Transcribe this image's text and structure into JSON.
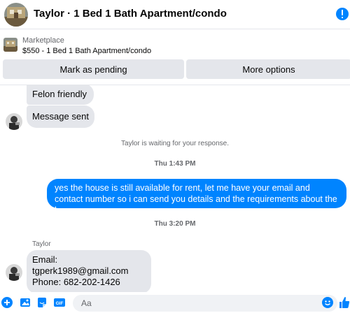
{
  "header": {
    "title": "Taylor · 1 Bed 1 Bath Apartment/condo"
  },
  "marketplace": {
    "label": "Marketplace",
    "listing": "$550 - 1 Bed 1 Bath Apartment/condo",
    "mark_pending": "Mark as pending",
    "more_options": "More options"
  },
  "messages": {
    "in1": "Felon friendly",
    "in2": "Message sent",
    "system_waiting": "Taylor is waiting for your response.",
    "time1": "Thu 1:43 PM",
    "out1": "yes the house is still available for rent, let me have your email  and contact number so i can send you details and the requirements about the house",
    "time2": "Thu 3:20 PM",
    "sender_name": "Taylor",
    "in3_line1": "Email: tgperk1989@gmail.com",
    "in3_line2": "Phone: 682-202-1426"
  },
  "composer": {
    "placeholder": "Aa"
  },
  "colors": {
    "accent": "#0084ff",
    "bubble_in": "#e4e6eb",
    "muted": "#65676b"
  },
  "icons": [
    "plus-circle-icon",
    "image-icon",
    "sticker-icon",
    "gif-icon",
    "emoji-icon",
    "thumbs-up-icon"
  ]
}
